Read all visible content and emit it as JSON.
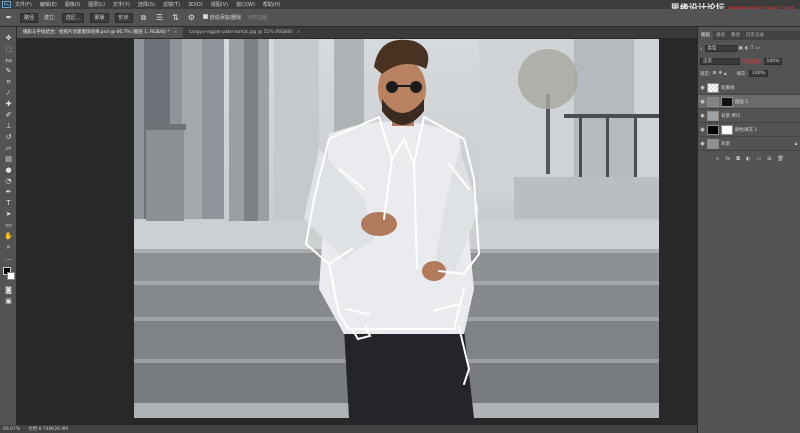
{
  "app": {
    "logo": "Ps"
  },
  "menu": [
    "文件(F)",
    "编辑(E)",
    "图像(I)",
    "图层(L)",
    "文字(Y)",
    "选择(S)",
    "滤镜(T)",
    "3D(D)",
    "视图(V)",
    "窗口(W)",
    "帮助(H)"
  ],
  "watermark": {
    "text": "思缘设计论坛",
    "site": "WWW.MISSYUAN.COM"
  },
  "options": {
    "path_mode": "路径",
    "make_label": "建立:",
    "selection_btn": "选区...",
    "mask_btn": "蒙版",
    "shape_btn": "形状",
    "auto_add_label": "自动添加/删除",
    "align_label": "对齐边缘"
  },
  "tabs": [
    {
      "label": "摄影与手绘结合：给照片创建服饰效果.psd @ 66.7% (图层 1, RGB/8) *",
      "active": true
    },
    {
      "label": "tangya-eggak-pake-tomat.jpg @ 51% (RGB/8)",
      "active": false
    }
  ],
  "status": {
    "zoom": "66.67%",
    "doc": "文档:8.74M/26.9M"
  },
  "panels": {
    "tabs": [
      "图层",
      "通道",
      "路径",
      "历史记录"
    ],
    "kind_label": "类型",
    "blend_mode": "正常",
    "opacity_label": "不透明度:",
    "opacity_value": "100%",
    "lock_label": "锁定:",
    "fill_label": "填充:",
    "fill_value": "100%",
    "layers": [
      {
        "name": "轮廓线",
        "selected": false
      },
      {
        "name": "图层 1",
        "selected": true
      },
      {
        "name": "背景 拷贝",
        "selected": false
      },
      {
        "name": "颜色填充 1",
        "selected": false
      },
      {
        "name": "背景",
        "selected": false
      }
    ],
    "footer_icons": [
      "link-icon",
      "fx-icon",
      "mask-icon",
      "adjustment-icon",
      "group-icon",
      "new-layer-icon",
      "trash-icon"
    ]
  },
  "colors": {
    "accent": "#e63a3a",
    "panel": "#535353",
    "canvas_bg": "#282828"
  }
}
